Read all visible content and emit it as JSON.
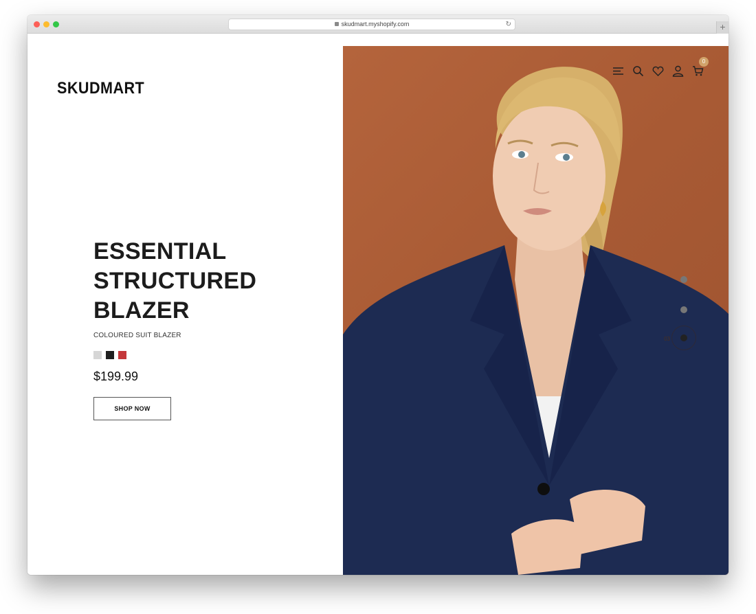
{
  "browser": {
    "url": "skudmart.myshopify.com",
    "reload_icon": "reload-icon",
    "new_tab": "+"
  },
  "site": {
    "logo": "SKUDMART"
  },
  "product": {
    "headline_line1": "ESSENTIAL",
    "headline_line2": "STRUCTURED",
    "headline_line3": "BLAZER",
    "subtitle": "COLOURED SUIT BLAZER",
    "swatches": [
      "#d6d6d6",
      "#1e1e1e",
      "#c4373a"
    ],
    "price": "$199.99",
    "cta": "SHOP NOW"
  },
  "header_icons": [
    "menu-icon",
    "search-icon",
    "heart-icon",
    "user-icon",
    "cart-icon"
  ],
  "cart": {
    "count": "0"
  },
  "slider": {
    "current_page": "03"
  },
  "colors": {
    "hero_background": "#a85a34",
    "badge": "#d1a36a",
    "blazer": "#1d2b52"
  }
}
